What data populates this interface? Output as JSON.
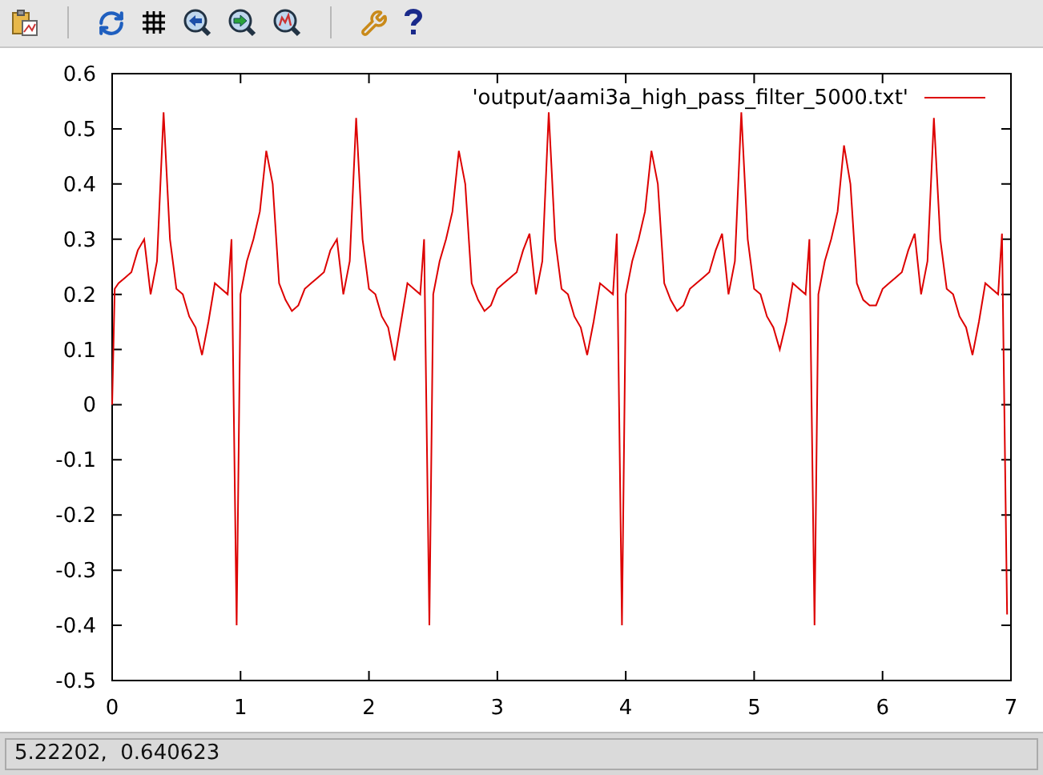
{
  "toolbar": {
    "buttons": [
      {
        "kind": "copy"
      },
      {
        "kind": "replot"
      },
      {
        "kind": "grid"
      },
      {
        "kind": "zoom-prev"
      },
      {
        "kind": "zoom-next"
      },
      {
        "kind": "unzoom"
      },
      {
        "kind": "separator"
      },
      {
        "kind": "config"
      },
      {
        "kind": "help"
      }
    ]
  },
  "plot": {
    "chart_data": {
      "type": "line",
      "xlim": [
        0,
        7
      ],
      "ylim": [
        -0.5,
        0.6
      ],
      "xticks": [
        0,
        1,
        2,
        3,
        4,
        5,
        6,
        7
      ],
      "yticks": [
        -0.5,
        -0.4,
        -0.3,
        -0.2,
        -0.1,
        0,
        0.1,
        0.2,
        0.3,
        0.4,
        0.5,
        0.6
      ],
      "x": [
        0,
        0.02,
        0.05,
        0.1,
        0.15,
        0.2,
        0.25,
        0.3,
        0.35,
        0.4,
        0.45,
        0.5,
        0.55,
        0.6,
        0.65,
        0.7,
        0.75,
        0.8,
        0.85,
        0.9,
        0.93,
        0.97,
        1,
        1.05,
        1.1,
        1.15,
        1.2,
        1.25,
        1.3,
        1.35,
        1.4,
        1.45,
        1.5,
        1.55,
        1.6,
        1.65,
        1.7,
        1.75,
        1.8,
        1.85,
        1.9,
        1.95,
        2,
        2.05,
        2.1,
        2.15,
        2.2,
        2.25,
        2.3,
        2.35,
        2.4,
        2.43,
        2.47,
        2.5,
        2.55,
        2.6,
        2.65,
        2.7,
        2.75,
        2.8,
        2.85,
        2.9,
        2.95,
        3,
        3.05,
        3.1,
        3.15,
        3.2,
        3.25,
        3.3,
        3.35,
        3.4,
        3.45,
        3.5,
        3.55,
        3.6,
        3.65,
        3.7,
        3.75,
        3.8,
        3.85,
        3.9,
        3.93,
        3.97,
        4,
        4.05,
        4.1,
        4.15,
        4.2,
        4.25,
        4.3,
        4.35,
        4.4,
        4.45,
        4.5,
        4.55,
        4.6,
        4.65,
        4.7,
        4.75,
        4.8,
        4.85,
        4.9,
        4.95,
        5,
        5.05,
        5.1,
        5.15,
        5.2,
        5.25,
        5.3,
        5.35,
        5.4,
        5.43,
        5.47,
        5.5,
        5.55,
        5.6,
        5.65,
        5.7,
        5.75,
        5.8,
        5.85,
        5.9,
        5.95,
        6,
        6.05,
        6.1,
        6.15,
        6.2,
        6.25,
        6.3,
        6.35,
        6.4,
        6.45,
        6.5,
        6.55,
        6.6,
        6.65,
        6.7,
        6.75,
        6.8,
        6.85,
        6.9,
        6.93,
        6.97
      ],
      "series": [
        {
          "name": "'output/aami3a_high_pass_filter_5000.txt'",
          "color": "#dd0000",
          "values": [
            0,
            0.21,
            0.22,
            0.23,
            0.24,
            0.28,
            0.3,
            0.2,
            0.26,
            0.53,
            0.3,
            0.21,
            0.2,
            0.16,
            0.14,
            0.09,
            0.15,
            0.22,
            0.21,
            0.2,
            0.3,
            -0.4,
            0.2,
            0.26,
            0.3,
            0.35,
            0.46,
            0.4,
            0.22,
            0.19,
            0.17,
            0.18,
            0.21,
            0.22,
            0.23,
            0.24,
            0.28,
            0.3,
            0.2,
            0.26,
            0.52,
            0.3,
            0.21,
            0.2,
            0.16,
            0.14,
            0.08,
            0.15,
            0.22,
            0.21,
            0.2,
            0.3,
            -0.4,
            0.2,
            0.26,
            0.3,
            0.35,
            0.46,
            0.4,
            0.22,
            0.19,
            0.17,
            0.18,
            0.21,
            0.22,
            0.23,
            0.24,
            0.28,
            0.31,
            0.2,
            0.26,
            0.53,
            0.3,
            0.21,
            0.2,
            0.16,
            0.14,
            0.09,
            0.15,
            0.22,
            0.21,
            0.2,
            0.31,
            -0.4,
            0.2,
            0.26,
            0.3,
            0.35,
            0.46,
            0.4,
            0.22,
            0.19,
            0.17,
            0.18,
            0.21,
            0.22,
            0.23,
            0.24,
            0.28,
            0.31,
            0.2,
            0.26,
            0.53,
            0.3,
            0.21,
            0.2,
            0.16,
            0.14,
            0.1,
            0.15,
            0.22,
            0.21,
            0.2,
            0.3,
            -0.4,
            0.2,
            0.26,
            0.3,
            0.35,
            0.47,
            0.4,
            0.22,
            0.19,
            0.18,
            0.18,
            0.21,
            0.22,
            0.23,
            0.24,
            0.28,
            0.31,
            0.2,
            0.26,
            0.52,
            0.3,
            0.21,
            0.2,
            0.16,
            0.14,
            0.09,
            0.15,
            0.22,
            0.21,
            0.2,
            0.31,
            -0.38
          ]
        }
      ]
    }
  },
  "status_bar": {
    "text": "5.22202,  0.640623"
  }
}
